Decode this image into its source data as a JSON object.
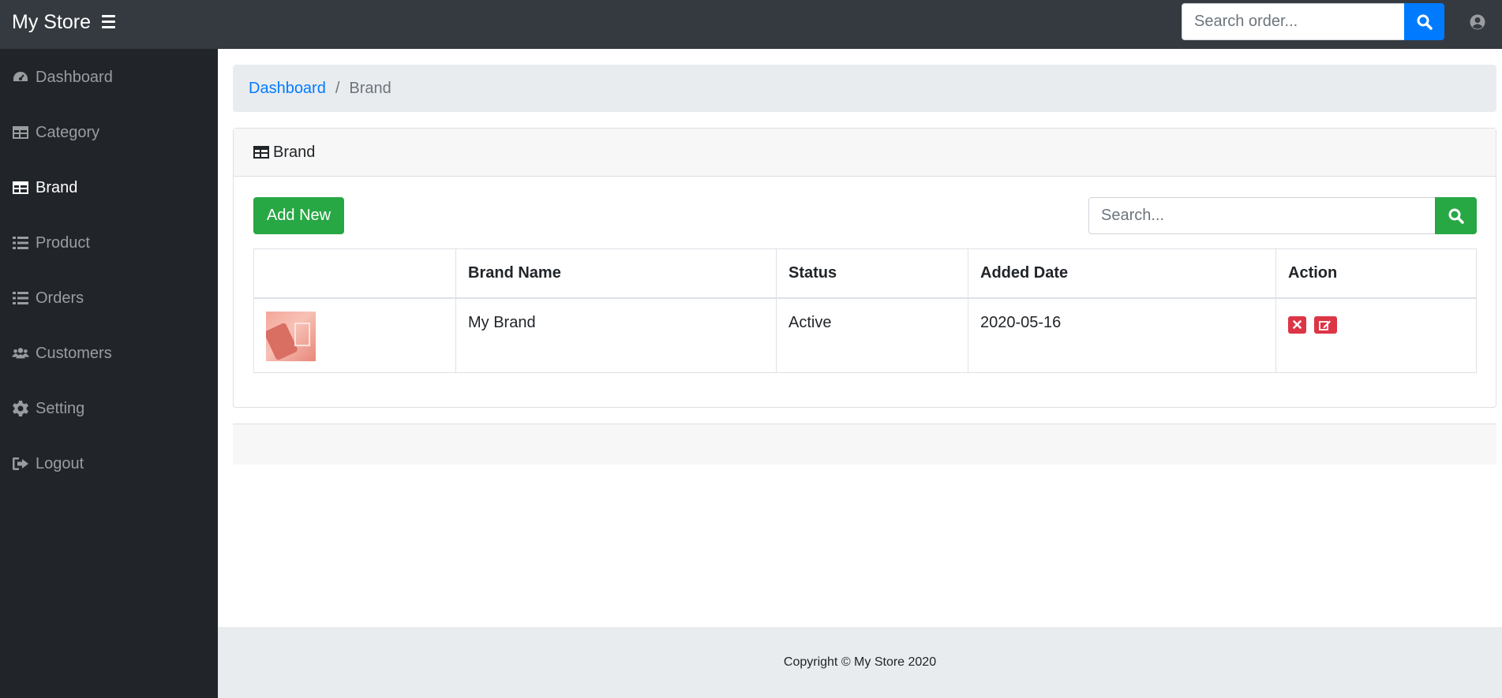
{
  "topbar": {
    "title": "My Store",
    "search_placeholder": "Search order..."
  },
  "sidebar": {
    "items": [
      {
        "label": "Dashboard",
        "icon": "dashboard-icon"
      },
      {
        "label": "Category",
        "icon": "table-icon"
      },
      {
        "label": "Brand",
        "icon": "table-icon",
        "active": true
      },
      {
        "label": "Product",
        "icon": "list-icon"
      },
      {
        "label": "Orders",
        "icon": "list-icon"
      },
      {
        "label": "Customers",
        "icon": "users-icon"
      },
      {
        "label": "Setting",
        "icon": "gear-icon"
      },
      {
        "label": "Logout",
        "icon": "sign-out-icon"
      }
    ]
  },
  "breadcrumb": {
    "home": "Dashboard",
    "separator": "/",
    "current": "Brand"
  },
  "card": {
    "title": "Brand",
    "add_label": "Add New",
    "search_placeholder": "Search...",
    "table": {
      "headers": [
        "",
        "Brand Name",
        "Status",
        "Added Date",
        "Action"
      ],
      "rows": [
        {
          "brand_name": "My Brand",
          "status": "Active",
          "added_date": "2020-05-16"
        }
      ]
    }
  },
  "footer": {
    "text": "Copyright © My Store 2020"
  },
  "colors": {
    "topbar": "#343a40",
    "sidebar": "#212529",
    "primary": "#007bff",
    "success": "#28a745",
    "danger": "#dc3545"
  }
}
